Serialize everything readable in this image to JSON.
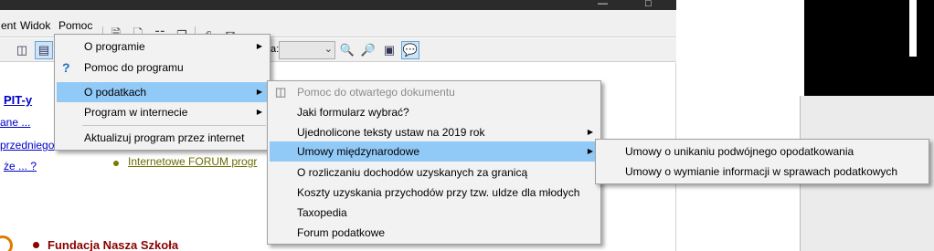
{
  "menubar": {
    "items": [
      "ent",
      "Widok",
      "Pomoc"
    ]
  },
  "toolbar2": {
    "label_fragment": "a:"
  },
  "content": {
    "links": [
      "PIT-y",
      "ane ...",
      "przedniego",
      "że ... ?"
    ],
    "forum": "Internetowe FORUM progr",
    "bottom": "Fundacja Nasza Szkoła"
  },
  "help_menu": {
    "items": [
      {
        "label": "O programie",
        "submenu": true
      },
      {
        "label": "Pomoc do programu",
        "icon": "question-icon"
      },
      {
        "label": "O podatkach",
        "submenu": true,
        "highlighted": true
      },
      {
        "label": "Program w internecie",
        "submenu": true
      },
      {
        "label": "Aktualizuj program przez internet"
      }
    ]
  },
  "taxes_menu": {
    "items": [
      {
        "label": "Pomoc do otwartego dokumentu",
        "disabled": true
      },
      {
        "label": "Jaki formularz wybrać?"
      },
      {
        "label": "Ujednolicone teksty ustaw na 2019 rok",
        "submenu": true
      },
      {
        "label": "Umowy międzynarodowe",
        "submenu": true,
        "highlighted": true
      },
      {
        "label": "O rozliczaniu dochodów uzyskanych za granicą"
      },
      {
        "label": "Koszty uzyskania przychodów przy tzw. uldze dla młodych"
      },
      {
        "label": "Taxopedia"
      },
      {
        "label": "Forum podatkowe"
      }
    ]
  },
  "treaties_menu": {
    "items": [
      {
        "label": "Umowy o unikaniu podwójnego opodatkowania"
      },
      {
        "label": "Umowy o wymianie informacji w sprawach podatkowych"
      }
    ]
  },
  "colors": {
    "highlight": "#91c9f7",
    "link": "#0000c8",
    "forum": "#6b6b00",
    "bottom_title": "#8b0000"
  }
}
